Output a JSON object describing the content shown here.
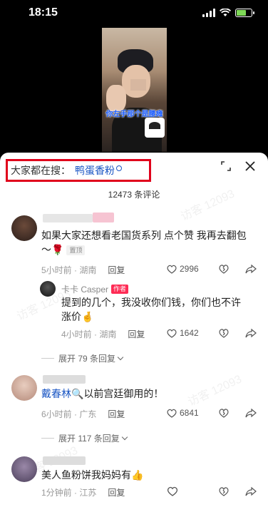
{
  "status_bar": {
    "time": "18:15"
  },
  "video": {
    "caption": "你左手那个是腰瘫"
  },
  "sheet": {
    "search_label": "大家都在搜：",
    "search_keyword": "鸭蛋香粉",
    "comment_count": "12473 条评论"
  },
  "comments": [
    {
      "text_line1": "如果大家还想看老国货系列 点个赞 我再去翻包",
      "text_line2": "～🌹",
      "pinned": "置顶",
      "time_loc": "5小时前 · 湖南",
      "reply": "回复",
      "likes": "2996"
    },
    {
      "author_name": "卡卡 Casper",
      "author_tag": "作者",
      "text_line1": "提到的几个，我没收你们钱，你们也不许",
      "text_line2": "涨价🤞",
      "time_loc": "4小时前 · 湖南",
      "reply": "回复",
      "likes": "1642",
      "expand": "展开 79 条回复"
    },
    {
      "mention": "戴春林🔍",
      "text": "以前宫廷御用的！",
      "time_loc": "6小时前 · 广东",
      "reply": "回复",
      "likes": "6841",
      "expand": "展开 117 条回复"
    },
    {
      "text": "美人鱼粉饼我妈妈有👍",
      "time_loc": "1分钟前 · 江苏",
      "reply": "回复"
    }
  ]
}
